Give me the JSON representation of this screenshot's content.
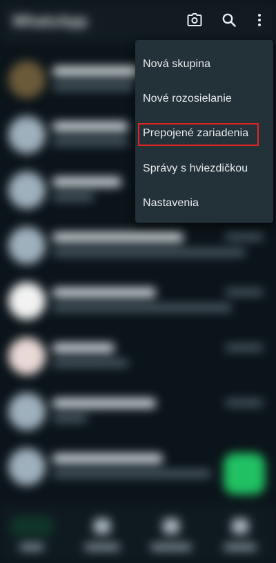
{
  "header": {
    "title": "WhatsApp",
    "icons": [
      "camera-icon",
      "search-icon",
      "more-options-icon"
    ]
  },
  "menu": {
    "items": [
      {
        "label": "Nová skupina"
      },
      {
        "label": "Nové rozosielanie"
      },
      {
        "label": "Prepojené zariadenia",
        "highlighted": true
      },
      {
        "label": "Správy s hviezdičkou"
      },
      {
        "label": "Nastavenia"
      }
    ],
    "highlight_color": "#e02424"
  },
  "colors": {
    "background": "#0b141a",
    "menu_background": "#233138",
    "text": "#e9edef",
    "accent": "#21c063"
  }
}
